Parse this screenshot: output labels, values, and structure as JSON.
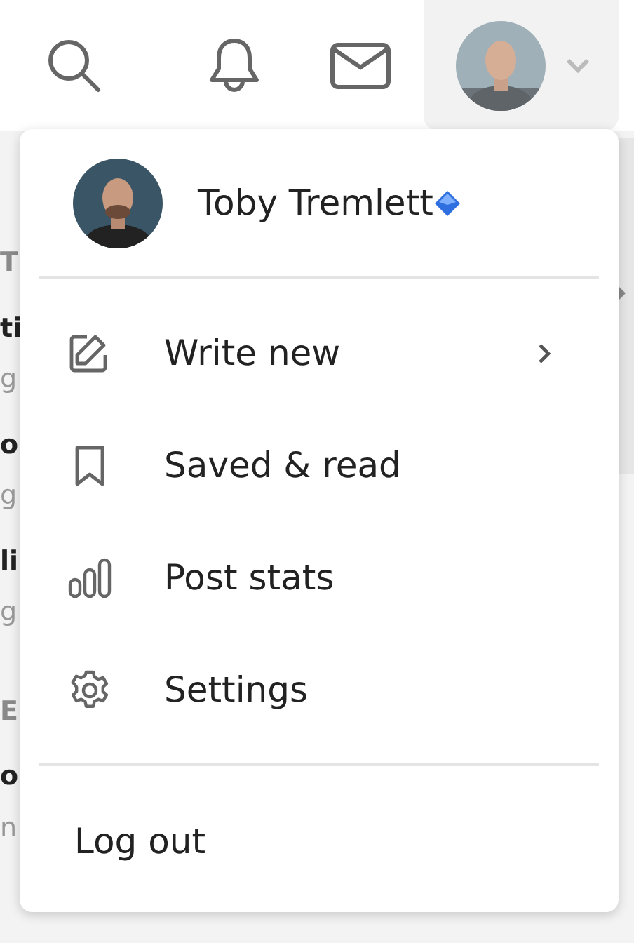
{
  "background_fragments": [
    {
      "text": "T",
      "kind": "heading"
    },
    {
      "text": "ti",
      "kind": "title"
    },
    {
      "text": "g",
      "kind": "meta"
    },
    {
      "text": "o",
      "kind": "title"
    },
    {
      "text": "g",
      "kind": "meta"
    },
    {
      "text": "li",
      "kind": "title"
    },
    {
      "text": "g",
      "kind": "meta"
    },
    {
      "text": "E",
      "kind": "heading"
    },
    {
      "text": "o",
      "kind": "title"
    },
    {
      "text": "n",
      "kind": "meta"
    }
  ],
  "profile": {
    "name": "Toby Tremlett",
    "verified": true
  },
  "menu_items": [
    {
      "label": "Write new",
      "submenu": true
    },
    {
      "label": "Saved & read",
      "submenu": false
    },
    {
      "label": "Post stats",
      "submenu": false
    },
    {
      "label": "Settings",
      "submenu": false
    }
  ],
  "logout": {
    "label": "Log out"
  }
}
